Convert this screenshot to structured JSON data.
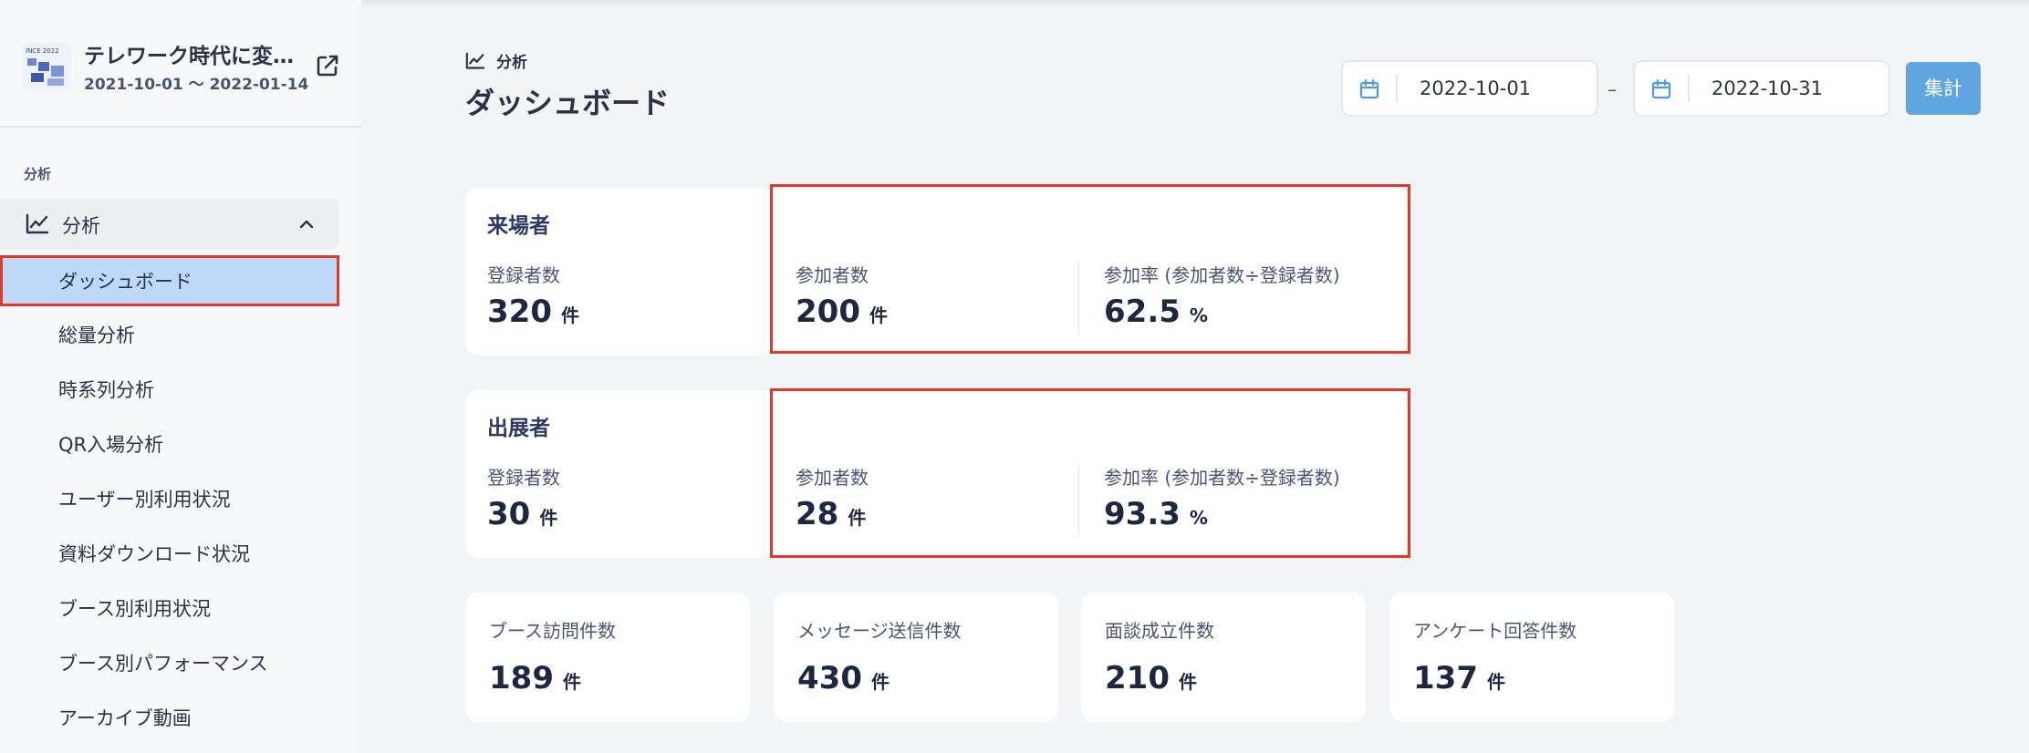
{
  "event": {
    "title": "テレワーク時代に変…",
    "dates": "2021-10-01 ～ 2022-01-14",
    "logo_text": "INCE 2022"
  },
  "sidebar": {
    "section_label": "分析",
    "group_label": "分析",
    "items": [
      {
        "label": "ダッシュボード",
        "active": true
      },
      {
        "label": "総量分析"
      },
      {
        "label": "時系列分析"
      },
      {
        "label": "QR入場分析"
      },
      {
        "label": "ユーザー別利用状況"
      },
      {
        "label": "資料ダウンロード状況"
      },
      {
        "label": "ブース別利用状況"
      },
      {
        "label": "ブース別パフォーマンス"
      },
      {
        "label": "アーカイブ動画"
      }
    ]
  },
  "header": {
    "breadcrumb": "分析",
    "title": "ダッシュボード"
  },
  "filter": {
    "start_date": "2022-10-01",
    "end_date": "2022-10-31",
    "dash": "–",
    "submit_label": "集計"
  },
  "visitors": {
    "title": "来場者",
    "registered_label": "登録者数",
    "registered_value": "320",
    "participants_label": "参加者数",
    "participants_value": "200",
    "rate_label": "参加率 (参加者数÷登録者数)",
    "rate_value": "62.5",
    "unit_count": "件",
    "unit_percent": "%"
  },
  "exhibitors": {
    "title": "出展者",
    "registered_label": "登録者数",
    "registered_value": "30",
    "participants_label": "参加者数",
    "participants_value": "28",
    "rate_label": "参加率 (参加者数÷登録者数)",
    "rate_value": "93.3",
    "unit_count": "件",
    "unit_percent": "%"
  },
  "stats": [
    {
      "label": "ブース訪問件数",
      "value": "189",
      "unit": "件"
    },
    {
      "label": "メッセージ送信件数",
      "value": "430",
      "unit": "件"
    },
    {
      "label": "面談成立件数",
      "value": "210",
      "unit": "件"
    },
    {
      "label": "アンケート回答件数",
      "value": "137",
      "unit": "件"
    }
  ],
  "colors": {
    "accent": "#5fa5df",
    "active_nav": "#bcd9f7",
    "highlight": "#e03a2e"
  }
}
